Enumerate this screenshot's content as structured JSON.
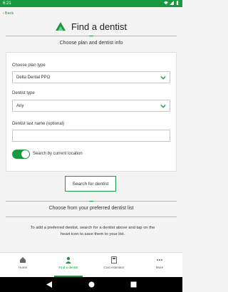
{
  "status": {
    "time": "6:21"
  },
  "back": {
    "label": "Back"
  },
  "header": {
    "title": "Find a dentist",
    "subtitle": "Choose plan and dentist info"
  },
  "form": {
    "plan_label": "Choose plan type",
    "plan_value": "Delta Dental PPO",
    "dentist_type_label": "Dentist type",
    "dentist_type_value": "Any",
    "last_name_label": "Dentist last name (optional)",
    "last_name_value": "",
    "location_toggle_label": "Search by current location",
    "location_toggle_on": true
  },
  "search_button": {
    "label": "Search for dentist"
  },
  "preferred": {
    "title": "Choose from your preferred dentist list",
    "message": "To add a preferred dentist, search for a dentist above and tap on the heart icon to save them to your list."
  },
  "nav": {
    "tabs": [
      {
        "label": "Home",
        "icon": "home-icon"
      },
      {
        "label": "Find a dentist",
        "icon": "dentist-icon"
      },
      {
        "label": "Cost estimator",
        "icon": "calculator-icon"
      },
      {
        "label": "More",
        "icon": "more-icon"
      }
    ]
  },
  "colors": {
    "accent": "#1a9a3e",
    "background": "#f4f4f4"
  }
}
